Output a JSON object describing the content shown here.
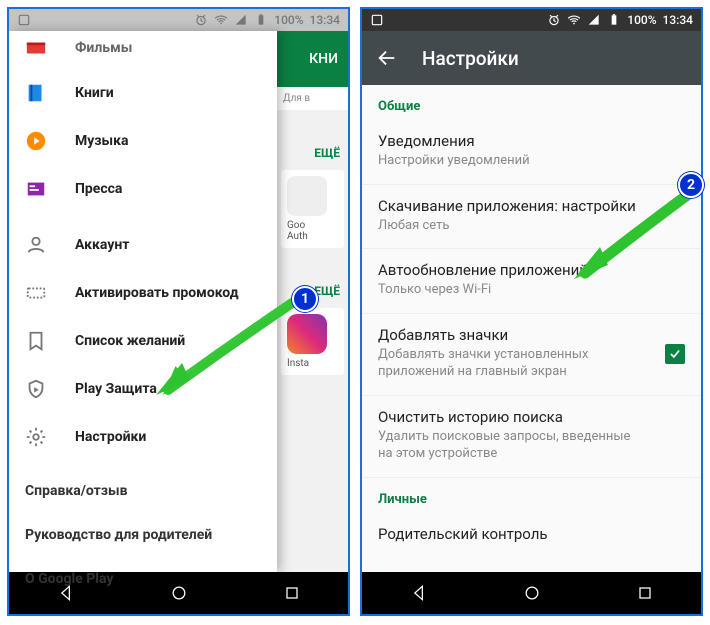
{
  "status": {
    "battery": "100%",
    "time": "13:34"
  },
  "drawer": {
    "items_top": [
      {
        "icon": "films",
        "label": "Фильмы"
      },
      {
        "icon": "books",
        "label": "Книги"
      },
      {
        "icon": "music",
        "label": "Музыка"
      },
      {
        "icon": "press",
        "label": "Пресса"
      }
    ],
    "items_mid": [
      {
        "icon": "account",
        "label": "Аккаунт"
      },
      {
        "icon": "promo",
        "label": "Активировать промокод"
      },
      {
        "icon": "wishlist",
        "label": "Список желаний"
      },
      {
        "icon": "protect",
        "label": "Play Защита"
      },
      {
        "icon": "settings",
        "label": "Настройки"
      }
    ],
    "items_bottom": [
      "Справка/отзыв",
      "Руководство для родителей",
      "О Google Play"
    ]
  },
  "bg": {
    "tab": "КНИ",
    "sub": "Для в",
    "more": "ЕЩЁ",
    "tile1a": "Goo",
    "tile1b": "Auth",
    "tile2": "Insta"
  },
  "settings": {
    "title": "Настройки",
    "section1": "Общие",
    "section2": "Личные",
    "items": [
      {
        "t1": "Уведомления",
        "t2": "Настройки уведомлений"
      },
      {
        "t1": "Скачивание приложения: настройки",
        "t2": "Любая сеть"
      },
      {
        "t1": "Автообновление приложений",
        "t2": "Только через Wi-Fi"
      },
      {
        "t1": "Добавлять значки",
        "t2": "Добавлять значки установленных приложений на главный экран",
        "checkbox": true
      },
      {
        "t1": "Очистить историю поиска",
        "t2": "Удалить поисковые запросы, введенные на этом устройстве"
      }
    ],
    "personal1": "Родительский контроль"
  },
  "markers": {
    "m1": "1",
    "m2": "2"
  }
}
